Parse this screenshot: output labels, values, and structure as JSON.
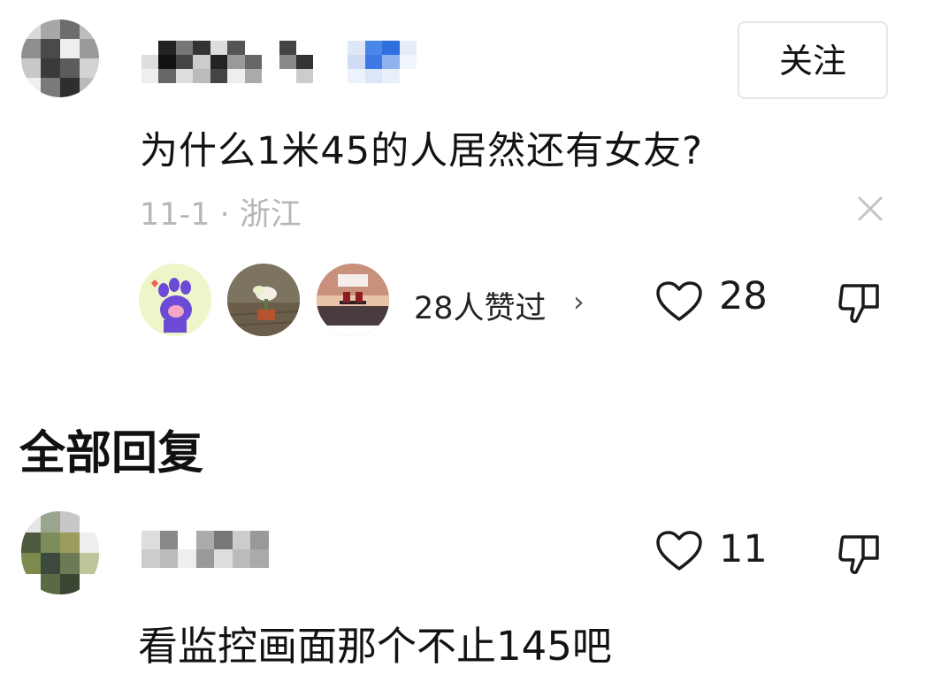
{
  "post": {
    "author": {
      "avatar_icon": "blurred-avatar",
      "name_obscured": true
    },
    "follow_label": "关注",
    "content": "为什么1米45的人居然还有女友?",
    "date": "11-1",
    "separator": " · ",
    "location": "浙江",
    "liked_by_text": "28人赞过",
    "liked_by_chevron": "›",
    "like_count": "28",
    "colors": {
      "meta": "#b6b6b6",
      "text": "#121212"
    }
  },
  "replies": {
    "section_title": "全部回复",
    "items": [
      {
        "avatar_icon": "blurred-avatar",
        "like_count": "11",
        "content": "看监控画面那个不止145吧"
      }
    ]
  }
}
